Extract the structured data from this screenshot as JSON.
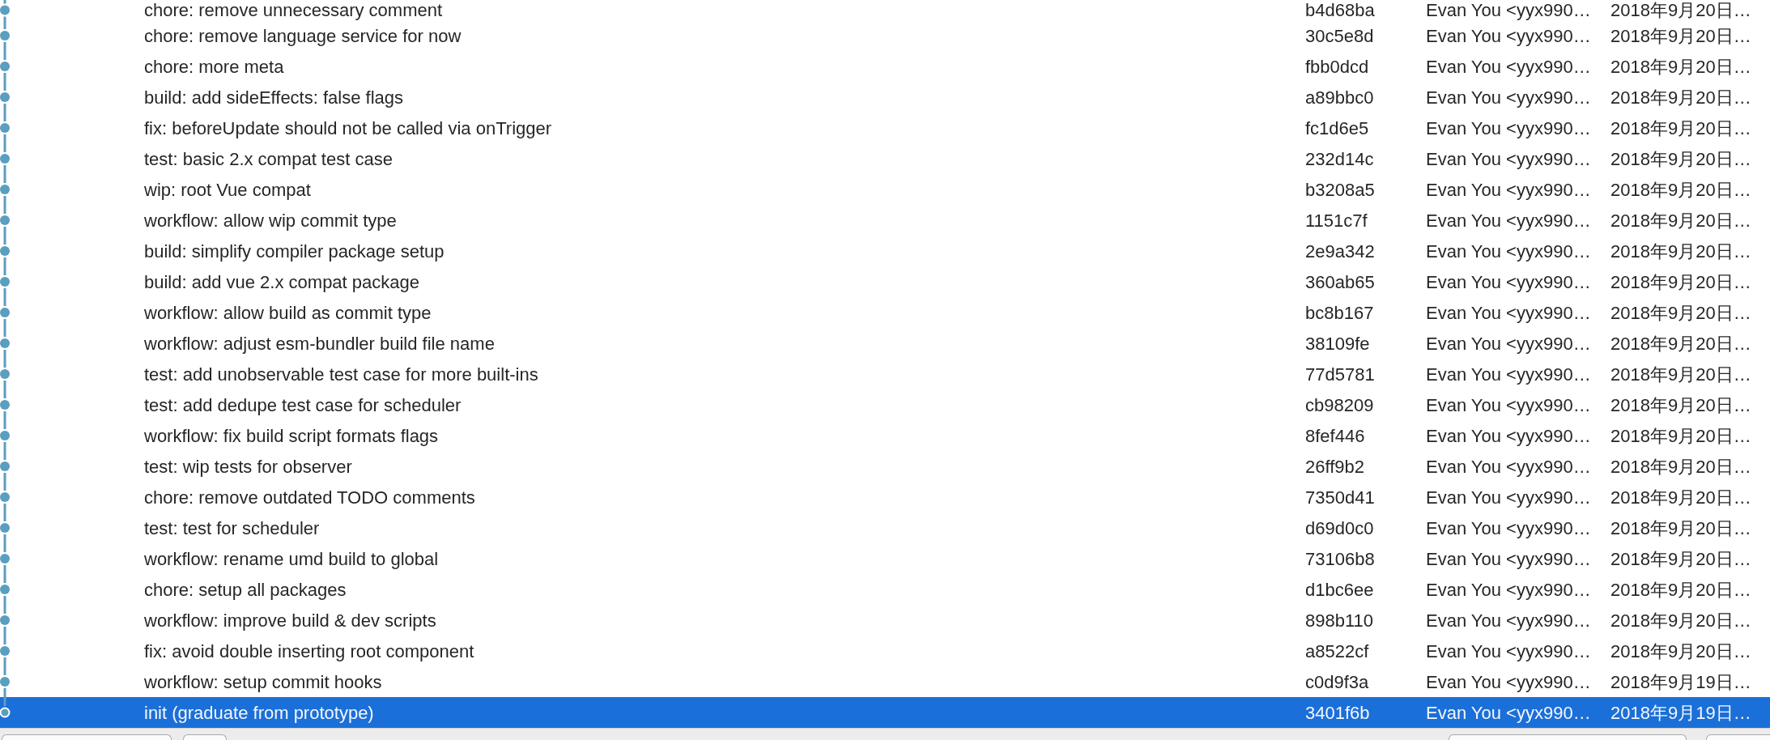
{
  "table": {
    "rows": [
      {
        "cells": [
          "chore: remove unnecessary comment",
          "b4d68ba",
          "Evan You <yyx990…",
          "2018年9月20日…"
        ],
        "selected": false
      },
      {
        "cells": [
          "chore: remove language service for now",
          "30c5e8d",
          "Evan You <yyx990…",
          "2018年9月20日…"
        ],
        "selected": false
      },
      {
        "cells": [
          "chore: more meta",
          "fbb0dcd",
          "Evan You <yyx990…",
          "2018年9月20日…"
        ],
        "selected": false
      },
      {
        "cells": [
          "build: add sideEffects: false flags",
          "a89bbc0",
          "Evan You <yyx990…",
          "2018年9月20日…"
        ],
        "selected": false
      },
      {
        "cells": [
          "fix: beforeUpdate should not be called via onTrigger",
          "fc1d6e5",
          "Evan You <yyx990…",
          "2018年9月20日…"
        ],
        "selected": false
      },
      {
        "cells": [
          "test: basic 2.x compat test case",
          "232d14c",
          "Evan You <yyx990…",
          "2018年9月20日…"
        ],
        "selected": false
      },
      {
        "cells": [
          "wip: root Vue compat",
          "b3208a5",
          "Evan You <yyx990…",
          "2018年9月20日…"
        ],
        "selected": false
      },
      {
        "cells": [
          "workflow: allow wip commit type",
          "1151c7f",
          "Evan You <yyx990…",
          "2018年9月20日…"
        ],
        "selected": false
      },
      {
        "cells": [
          "build: simplify compiler package setup",
          "2e9a342",
          "Evan You <yyx990…",
          "2018年9月20日…"
        ],
        "selected": false
      },
      {
        "cells": [
          "build: add vue 2.x compat package",
          "360ab65",
          "Evan You <yyx990…",
          "2018年9月20日…"
        ],
        "selected": false
      },
      {
        "cells": [
          "workflow: allow build as commit type",
          "bc8b167",
          "Evan You <yyx990…",
          "2018年9月20日…"
        ],
        "selected": false
      },
      {
        "cells": [
          "workflow: adjust esm-bundler build file name",
          "38109fe",
          "Evan You <yyx990…",
          "2018年9月20日…"
        ],
        "selected": false
      },
      {
        "cells": [
          "test: add unobservable test case for more built-ins",
          "77d5781",
          "Evan You <yyx990…",
          "2018年9月20日…"
        ],
        "selected": false
      },
      {
        "cells": [
          "test: add dedupe test case for scheduler",
          "cb98209",
          "Evan You <yyx990…",
          "2018年9月20日…"
        ],
        "selected": false
      },
      {
        "cells": [
          "workflow: fix build script formats flags",
          "8fef446",
          "Evan You <yyx990…",
          "2018年9月20日…"
        ],
        "selected": false
      },
      {
        "cells": [
          "test: wip tests for observer",
          "26ff9b2",
          "Evan You <yyx990…",
          "2018年9月20日…"
        ],
        "selected": false
      },
      {
        "cells": [
          "chore: remove outdated TODO comments",
          "7350d41",
          "Evan You <yyx990…",
          "2018年9月20日…"
        ],
        "selected": false
      },
      {
        "cells": [
          "test: test for scheduler",
          "d69d0c0",
          "Evan You <yyx990…",
          "2018年9月20日…"
        ],
        "selected": false
      },
      {
        "cells": [
          "workflow: rename umd build to global",
          "73106b8",
          "Evan You <yyx990…",
          "2018年9月20日…"
        ],
        "selected": false
      },
      {
        "cells": [
          "chore: setup all packages",
          "d1bc6ee",
          "Evan You <yyx990…",
          "2018年9月20日…"
        ],
        "selected": false
      },
      {
        "cells": [
          "workflow: improve build & dev scripts",
          "898b110",
          "Evan You <yyx990…",
          "2018年9月20日…"
        ],
        "selected": false
      },
      {
        "cells": [
          "fix: avoid double inserting root component",
          "a8522cf",
          "Evan You <yyx990…",
          "2018年9月20日…"
        ],
        "selected": false
      },
      {
        "cells": [
          "workflow: setup commit hooks",
          "c0d9f3a",
          "Evan You <yyx990…",
          "2018年9月19日…"
        ],
        "selected": false
      },
      {
        "cells": [
          "init (graduate from prototype)",
          "3401f6b",
          "Evan You <yyx990…",
          "2018年9月19日…"
        ],
        "selected": true
      }
    ]
  }
}
